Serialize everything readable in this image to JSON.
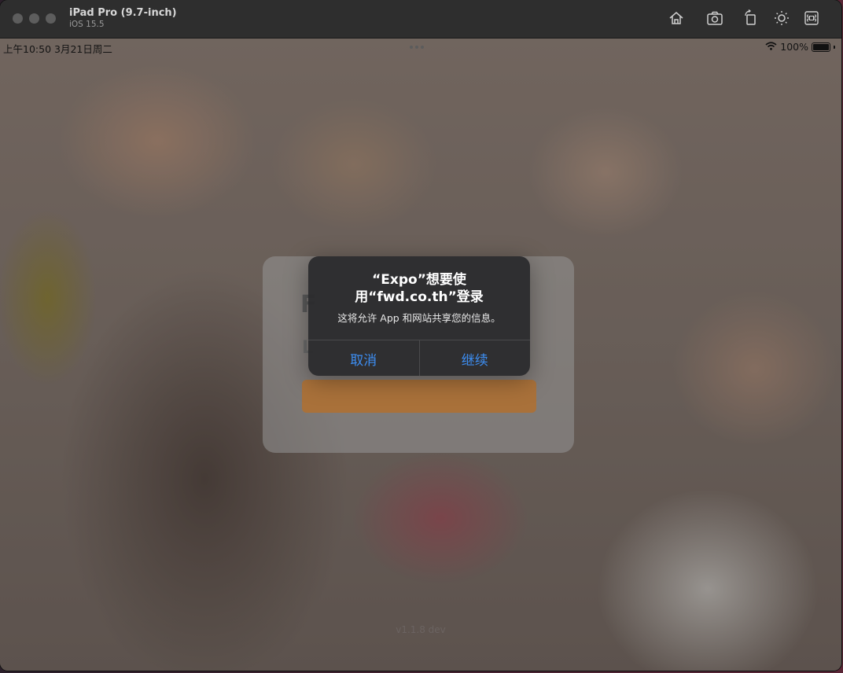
{
  "simulator": {
    "device_name": "iPad Pro (9.7-inch)",
    "os_version": "iOS 15.5",
    "toolbar_icons": [
      "home-icon",
      "screenshot-icon",
      "rotate-icon",
      "appearance-icon",
      "command-icon"
    ]
  },
  "status_bar": {
    "time_date": "上午10:50  3月21日周二",
    "battery": "100%"
  },
  "app": {
    "version": "v1.1.8 dev"
  },
  "alert": {
    "title": "“Expo”想要使用“fwd.co.th”登录",
    "message": "这将允许 App 和网站共享您的信息。",
    "cancel_label": "取消",
    "continue_label": "继续",
    "button_color": "#3d8ef2"
  }
}
